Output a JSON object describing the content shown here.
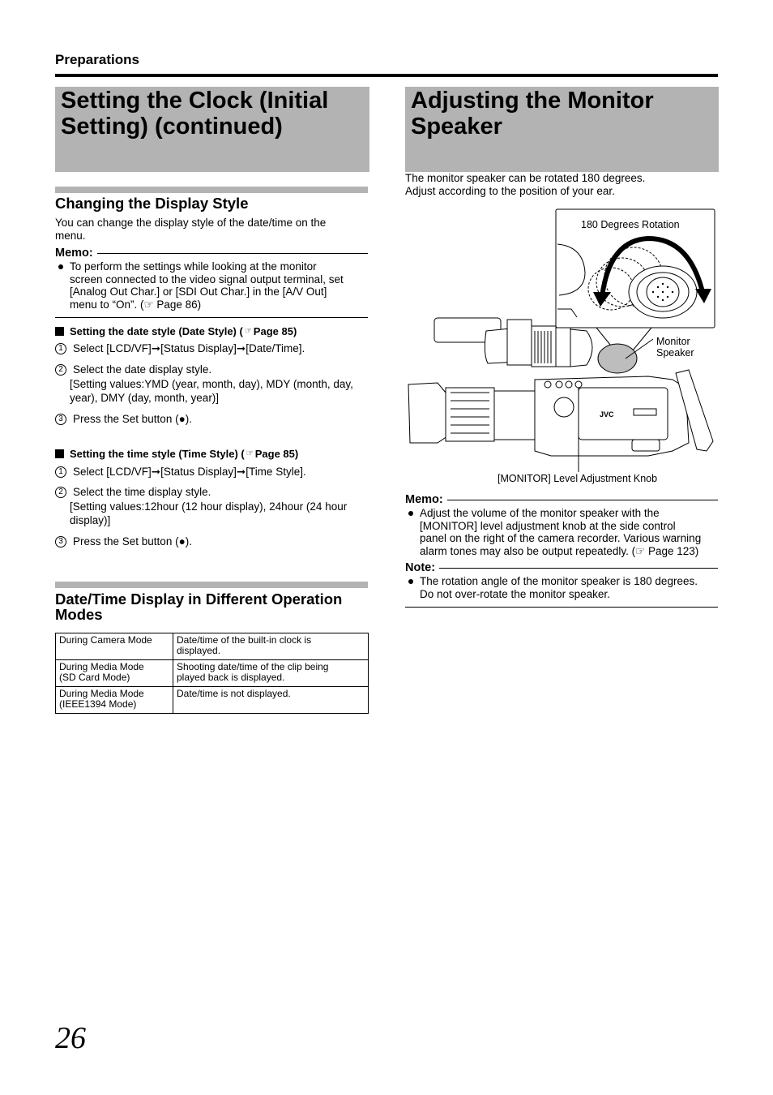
{
  "header": {
    "section": "Preparations"
  },
  "left": {
    "title": [
      "Setting the Clock (Initial",
      "Setting) (continued)"
    ],
    "display_style": {
      "heading": "Changing the Display Style",
      "intro": [
        "You can change the display style of the date/time on the",
        "menu."
      ],
      "memo_label": "Memo:",
      "memo_lines": [
        "To perform the settings while looking at the monitor",
        "screen connected to the video signal output terminal, set",
        "[Analog Out Char.] or [SDI Out Char.] in the [A/V Out]",
        "menu to “On”. (☞ Page 86)"
      ]
    },
    "date_style": {
      "heading": "Setting the date style (Date Style) (",
      "ref": "Page 85)",
      "steps": [
        {
          "num": "1",
          "text": "Select [LCD/VF]➞[Status Display]➞[Date/Time]."
        },
        {
          "num": "2",
          "text": "Select the date display style.",
          "sub": [
            "[Setting values:YMD (year, month, day), MDY (month, day,",
            "year), DMY (day, month, year)]"
          ]
        },
        {
          "num": "3",
          "text": "Press the Set button (●)."
        }
      ]
    },
    "time_style": {
      "heading": "Setting the time style (Time Style) (",
      "ref": "Page 85)",
      "steps": [
        {
          "num": "1",
          "text": "Select [LCD/VF]➞[Status Display]➞[Time Style]."
        },
        {
          "num": "2",
          "text": "Select the time display style.",
          "sub": [
            "[Setting values:12hour (12 hour display), 24hour (24 hour",
            "display)]"
          ]
        },
        {
          "num": "3",
          "text": "Press the Set button (●)."
        }
      ]
    },
    "modes": {
      "heading": [
        "Date/Time Display in Different Operation",
        "Modes"
      ],
      "rows": [
        {
          "mode": [
            "During Camera Mode"
          ],
          "desc": [
            "Date/time of the built-in clock is",
            "displayed."
          ]
        },
        {
          "mode": [
            "During Media Mode",
            "(SD Card Mode)"
          ],
          "desc": [
            "Shooting date/time of the clip being",
            "played back is displayed."
          ]
        },
        {
          "mode": [
            "During Media Mode",
            "(IEEE1394 Mode)"
          ],
          "desc": [
            "Date/time is not displayed."
          ]
        }
      ]
    }
  },
  "right": {
    "title": [
      "Adjusting the Monitor",
      "Speaker"
    ],
    "intro": [
      "The monitor speaker can be rotated 180 degrees.",
      "Adjust according to the position of your ear."
    ],
    "figure": {
      "rotation_label": "180 Degrees Rotation",
      "speaker_label": [
        "Monitor",
        "Speaker"
      ],
      "knob_label": "[MONITOR] Level Adjustment Knob",
      "brand": "JVC"
    },
    "memo_label": "Memo:",
    "memo_lines": [
      "Adjust the volume of the monitor speaker with the",
      "[MONITOR] level adjustment knob at the side control",
      "panel on the right of the camera recorder. Various warning",
      "alarm tones may also be output repeatedly. (☞ Page 123)"
    ],
    "note_label": "Note:",
    "note_lines": [
      "The rotation angle of the monitor speaker is 180 degrees.",
      "Do not over-rotate the monitor speaker."
    ]
  },
  "footer": {
    "page_number": "26"
  }
}
